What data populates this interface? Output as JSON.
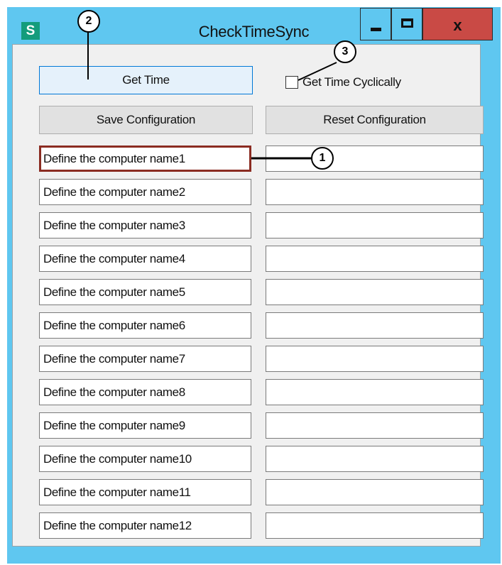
{
  "window": {
    "title": "CheckTimeSync",
    "app_icon_letter": "S",
    "controls": {
      "minimize": "minimize",
      "maximize": "maximize",
      "close": "x"
    }
  },
  "toolbar": {
    "get_time_label": "Get Time",
    "get_time_cyclically_label": "Get Time Cyclically",
    "get_time_cyclically_checked": false,
    "save_label": "Save Configuration",
    "reset_label": "Reset Configuration"
  },
  "computers": [
    {
      "name": "Define the computer name1",
      "result": ""
    },
    {
      "name": "Define the computer name2",
      "result": ""
    },
    {
      "name": "Define the computer name3",
      "result": ""
    },
    {
      "name": "Define the computer name4",
      "result": ""
    },
    {
      "name": "Define the computer name5",
      "result": ""
    },
    {
      "name": "Define the computer name6",
      "result": ""
    },
    {
      "name": "Define the computer name7",
      "result": ""
    },
    {
      "name": "Define the computer name8",
      "result": ""
    },
    {
      "name": "Define the computer name9",
      "result": ""
    },
    {
      "name": "Define the computer name10",
      "result": ""
    },
    {
      "name": "Define the computer name11",
      "result": ""
    },
    {
      "name": "Define the computer name12",
      "result": ""
    }
  ],
  "callouts": [
    "1",
    "2",
    "3"
  ],
  "colors": {
    "titlebar": "#5fc7f0",
    "close_button": "#c94a45",
    "app_icon": "#149c7c",
    "highlight_border": "#8b2c22",
    "focused_button_border": "#0078d7"
  }
}
